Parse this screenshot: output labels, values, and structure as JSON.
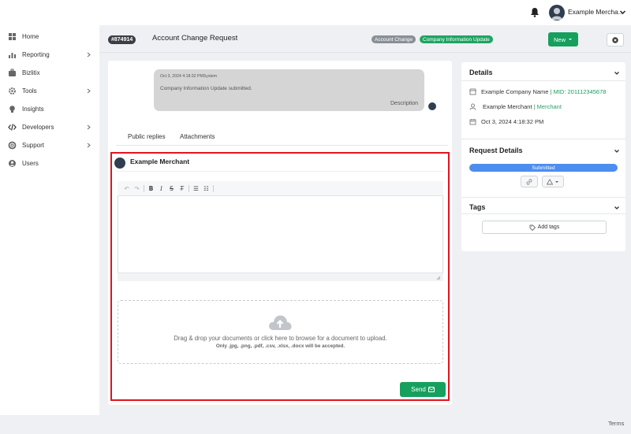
{
  "topbar": {
    "user_name": "Example Mercha..."
  },
  "sidebar": {
    "items": [
      {
        "label": "Home",
        "icon": "home-icon",
        "has_submenu": false
      },
      {
        "label": "Reporting",
        "icon": "bar-chart-icon",
        "has_submenu": true
      },
      {
        "label": "Bizlitix",
        "icon": "briefcase-icon",
        "has_submenu": false
      },
      {
        "label": "Tools",
        "icon": "gear-icon",
        "has_submenu": true
      },
      {
        "label": "Insights",
        "icon": "lightbulb-icon",
        "has_submenu": false
      },
      {
        "label": "Developers",
        "icon": "code-icon",
        "has_submenu": true
      },
      {
        "label": "Support",
        "icon": "lifebuoy-icon",
        "has_submenu": true
      },
      {
        "label": "Users",
        "icon": "user-circle-icon",
        "has_submenu": false
      }
    ]
  },
  "header": {
    "ticket_id": "#874914",
    "title": "Account Change Request",
    "badge_category": "Account Change",
    "badge_type": "Company Information Update",
    "new_label": "New",
    "colors": {
      "green": "#16a05d",
      "grey_badge": "#8a8f96"
    }
  },
  "message": {
    "timestamp": "Oct 3, 2024 4:18:32 PMSystem",
    "text": "Company Information Update submitted.",
    "label": "Description"
  },
  "tabs": [
    {
      "label": "Public replies"
    },
    {
      "label": "Attachments"
    }
  ],
  "reply": {
    "author": "Example Merchant",
    "dropzone_line1": "Drag & drop your documents or click here to browse for a document to upload.",
    "dropzone_line2": "Only .jpg, .png, .pdf, .csv, .xlsx, .docx will be accepted.",
    "send_label": "Send",
    "highlight_color": "#e0141e"
  },
  "details": {
    "title": "Details",
    "company_name": "Example Company Name",
    "mid": "| MID: 201112345678",
    "merchant_name": "Example Merchant",
    "merchant_role": "| Merchant",
    "created": "Oct 3, 2024 4:18:32 PM"
  },
  "request_details": {
    "title": "Request Details",
    "status": "Submitted",
    "status_color": "#4c8df0"
  },
  "tags": {
    "title": "Tags",
    "add_label": "Add tags"
  },
  "footer": {
    "terms": "Terms"
  }
}
